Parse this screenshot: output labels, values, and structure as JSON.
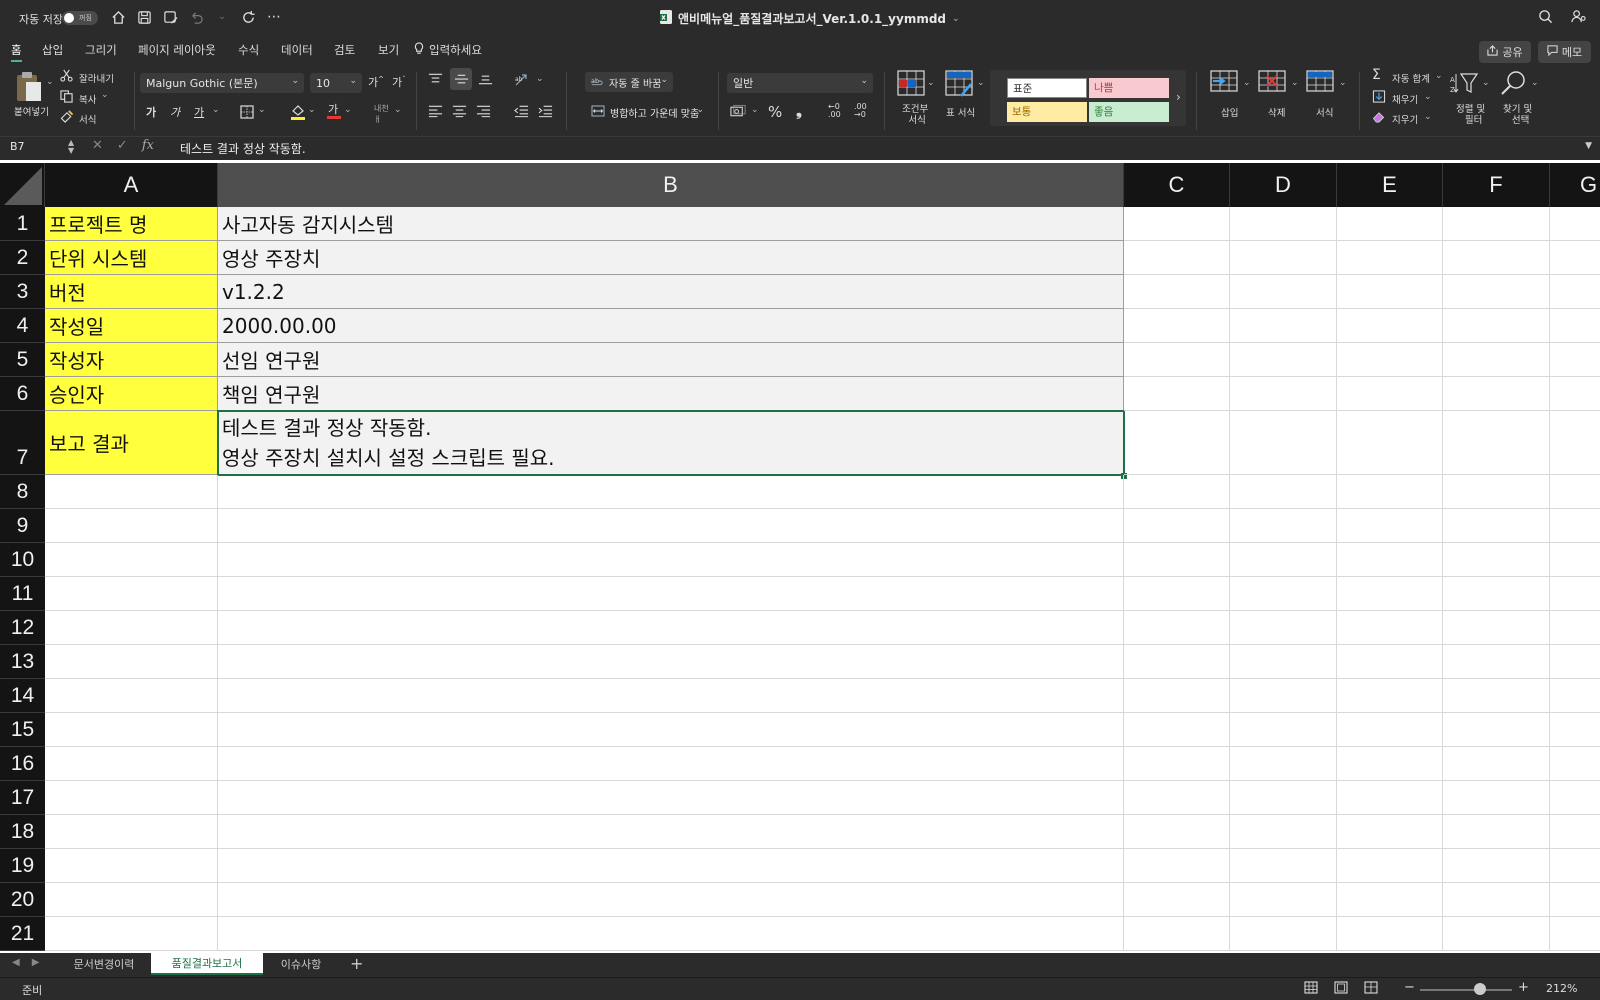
{
  "titlebar": {
    "autosave_label": "자동 저장",
    "autosave_state": "꺼짐",
    "doc_title": "앤비메뉴얼_품질결과보고서_Ver.1.0.1_yymmdd"
  },
  "tabs": [
    "홈",
    "삽입",
    "그리기",
    "페이지 레이아웃",
    "수식",
    "데이터",
    "검토",
    "보기"
  ],
  "tell_me": "입력하세요",
  "share_label": "공유",
  "memo_label": "메모",
  "ribbon": {
    "paste": "붙여넣기",
    "cut": "잘라내기",
    "copy": "복사",
    "format_painter": "서식",
    "font_name": "Malgun Gothic (본문)",
    "font_size": "10",
    "bold": "가",
    "italic": "가",
    "underline": "가",
    "wrap_text": "자동 줄 바꿈",
    "merge_center": "병합하고 가운데 맞춤",
    "number_format": "일반",
    "cond_format_1": "조건부",
    "cond_format_2": "서식",
    "table_format": "표 서식",
    "styles": {
      "normal": "표준",
      "bad": "나쁨",
      "neutral": "보통",
      "good": "좋음"
    },
    "insert": "삽입",
    "delete": "삭제",
    "format": "서식",
    "autosum": "자동 합계",
    "fill": "채우기",
    "clear": "지우기",
    "sort_filter_1": "정렬 및",
    "sort_filter_2": "필터",
    "find_select_1": "찾기 및",
    "find_select_2": "선택"
  },
  "formula_bar": {
    "name_box": "B7",
    "content": "테스트 결과 정상 작동함."
  },
  "columns": [
    "A",
    "B",
    "C",
    "D",
    "E",
    "F",
    "G"
  ],
  "rows": [
    {
      "num": "1",
      "a": "프로젝트 명",
      "b": "사고자동 감지시스템"
    },
    {
      "num": "2",
      "a": "단위 시스템",
      "b": "영상 주장치"
    },
    {
      "num": "3",
      "a": "버전",
      "b": "v1.2.2"
    },
    {
      "num": "4",
      "a": "작성일",
      "b": "2000.00.00"
    },
    {
      "num": "5",
      "a": "작성자",
      "b": "선임 연구원"
    },
    {
      "num": "6",
      "a": "승인자",
      "b": "책임 연구원"
    },
    {
      "num": "7",
      "a": "보고 결과",
      "b_lines": [
        "테스트 결과 정상 작동함.",
        "영상 주장치 설치시 설정 스크립트 필요."
      ]
    }
  ],
  "empty_rows": [
    "8",
    "9",
    "10",
    "11",
    "12",
    "13",
    "14",
    "15",
    "16",
    "17",
    "18",
    "19",
    "20",
    "21"
  ],
  "sheets": [
    "문서변경이력",
    "품질결과보고서",
    "이슈사항"
  ],
  "active_sheet": "품질결과보고서",
  "status": {
    "text": "준비",
    "zoom": "212%"
  },
  "colors": {
    "label_fill": "#ffff3d",
    "value_fill": "#f2f2f2",
    "accent": "#1e7145"
  }
}
